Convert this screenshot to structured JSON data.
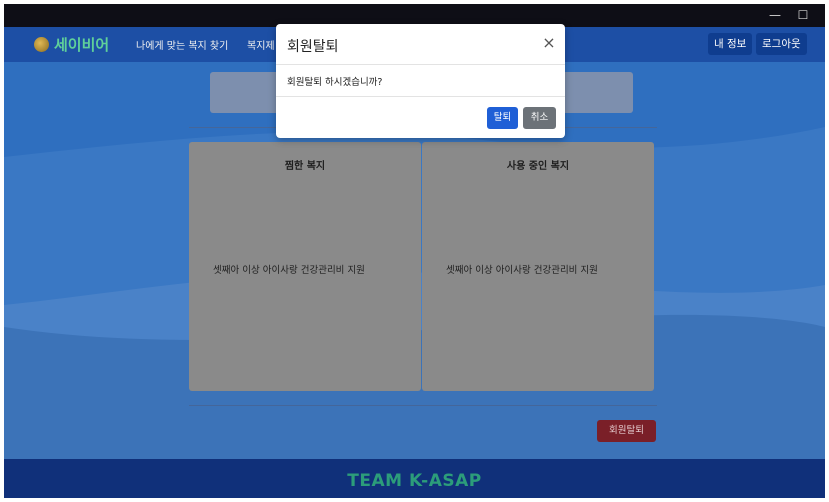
{
  "window": {
    "controls": {
      "minimize": "—",
      "maximize": "☐",
      "close": "✕"
    }
  },
  "nav": {
    "brand": "세이비어",
    "links": [
      "나에게 맞는 복지 찾기",
      "복지제"
    ],
    "buttons": {
      "info": "내 정보",
      "logout": "로그아웃"
    }
  },
  "cards": [
    {
      "title": "찜한 복지",
      "items": [
        "셋째아 이상 아이사랑 건강관리비 지원"
      ]
    },
    {
      "title": "사용 중인 복지",
      "items": [
        "셋째아 이상 아이사랑 건강관리비 지원"
      ]
    }
  ],
  "withdraw_button": "회원탈퇴",
  "footer": {
    "text": "TEAM K-ASAP"
  },
  "modal": {
    "title": "회원탈퇴",
    "close": "×",
    "body": "회원탈퇴 하시겠습니까?",
    "confirm": "탈퇴",
    "cancel": "취소"
  },
  "colors": {
    "background_blue": "#2f6fbf",
    "brand_green": "#5fd09a",
    "confirm_blue": "#1f5fd6",
    "cancel_gray": "#6c7278",
    "withdraw_red": "#7a1f28",
    "footer_green": "#2c9d7a"
  }
}
